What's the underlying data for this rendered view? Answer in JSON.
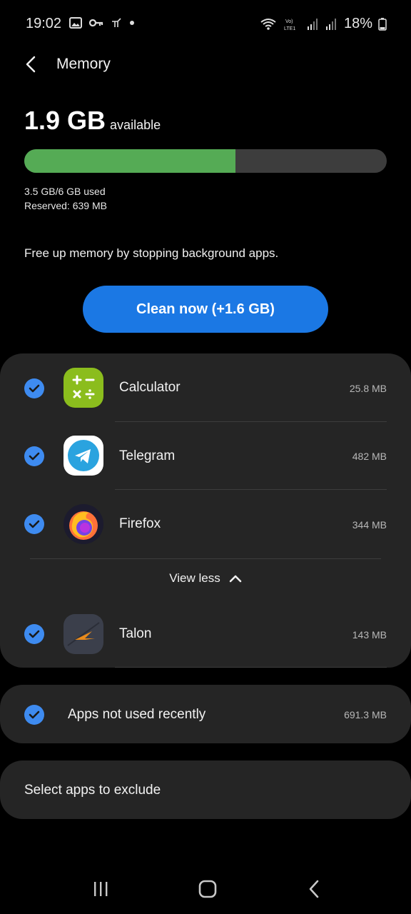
{
  "status_bar": {
    "time": "19:02",
    "icons": [
      "gallery-icon",
      "key-icon",
      "bird-icon",
      "dot-icon"
    ],
    "right_icons": [
      "wifi-call-icon",
      "volte-lte-icon",
      "signal-icon",
      "signal-icon"
    ],
    "battery": "18%"
  },
  "header": {
    "title": "Memory"
  },
  "memory": {
    "available_value": "1.9 GB",
    "available_label": "available",
    "used_fraction": 0.583,
    "used_text": "3.5 GB/6 GB used",
    "reserved_text": "Reserved: 639 MB",
    "bar_colors": {
      "used": "#55ab55",
      "free": "#3d3d3d"
    }
  },
  "hint": "Free up memory by stopping background apps.",
  "clean_button": "Clean now (+1.6 GB)",
  "apps": [
    {
      "name": "Calculator",
      "size": "25.8 MB",
      "icon": "calculator-icon",
      "checked": true
    },
    {
      "name": "Telegram",
      "size": "482 MB",
      "icon": "telegram-icon",
      "checked": true
    },
    {
      "name": "Firefox",
      "size": "344 MB",
      "icon": "firefox-icon",
      "checked": true
    },
    {
      "name": "Talon",
      "size": "143 MB",
      "icon": "talon-icon",
      "checked": true
    }
  ],
  "view_less": "View less",
  "not_used": {
    "label": "Apps not used recently",
    "size": "691.3 MB",
    "checked": true
  },
  "exclude": "Select apps to exclude",
  "nav": [
    "recents-icon",
    "home-icon",
    "back-icon"
  ],
  "colors": {
    "accent": "#1b78e4",
    "check": "#3e8bf0",
    "card": "#252525"
  }
}
